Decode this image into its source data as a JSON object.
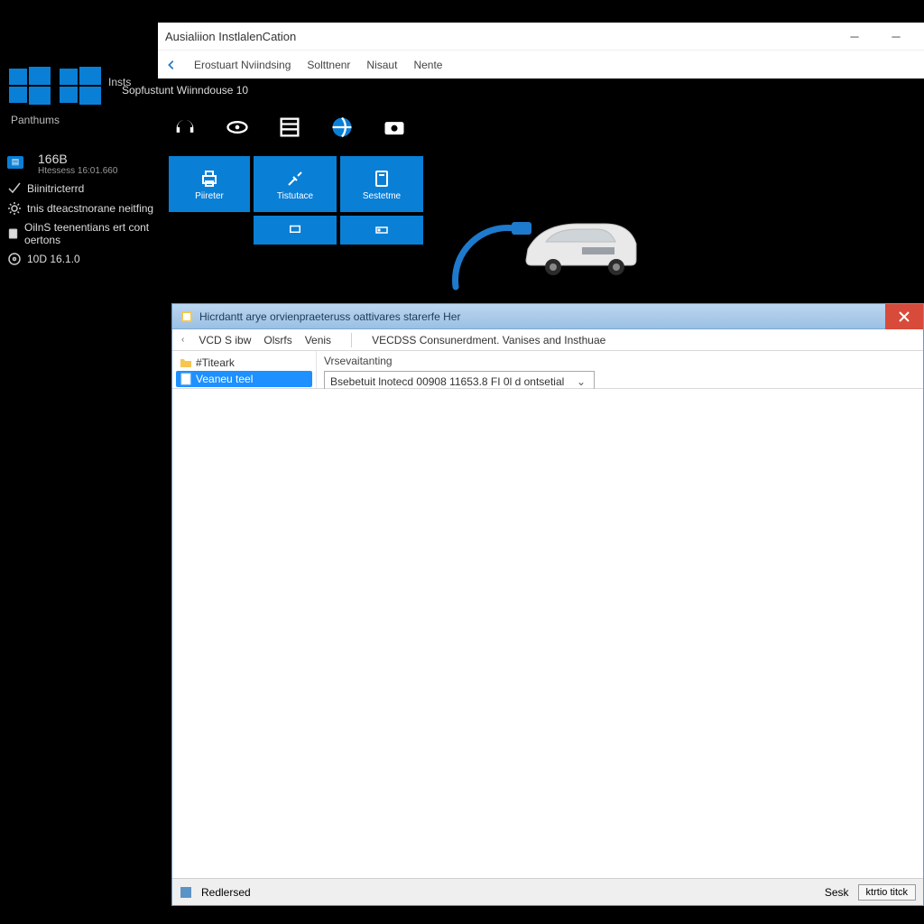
{
  "desktop": {
    "insts_label": "Insts",
    "subtitle": "Sopfustunt Wiinndouse 10",
    "panthums": "Panthums",
    "hd_group": {
      "big": "166B",
      "small": "Htessess 16:01.660"
    },
    "items": [
      "Biinitricterrd",
      "tnis dteacstnorane neitfing",
      "OilnS teenentians ert cont oertons",
      "10D 16.1.0"
    ]
  },
  "app": {
    "title": "Ausialiion InstlalenCation",
    "menu": [
      "Erostuart Nviindsing",
      "Solttnenr",
      "Nisaut",
      "Nente"
    ],
    "tiles": [
      {
        "label": "Piireter",
        "sub": ""
      },
      {
        "label": "Tistutace",
        "sub": ""
      },
      {
        "label": "Sestetme",
        "sub": ""
      }
    ]
  },
  "explorer": {
    "title": "Hicrdantt arye orvienpraeteruss oattivares starerfe Her",
    "menu_left": [
      "VCD S ibw",
      "Olsrfs",
      "Venis"
    ],
    "menu_right": "VECDSS Consunerdment. Vanises and Insthuae",
    "tree": {
      "parent": "#Titeark",
      "child": "Veaneu teel"
    },
    "field_label": "Vrsevaitanting",
    "combo_value": "Bsebetuit lnotecd 00908 11653.8 FI 0l d ontsetial",
    "status_left": "Redlersed",
    "status_btn1": "Sesk",
    "status_btn2": "ktrtio titck"
  }
}
